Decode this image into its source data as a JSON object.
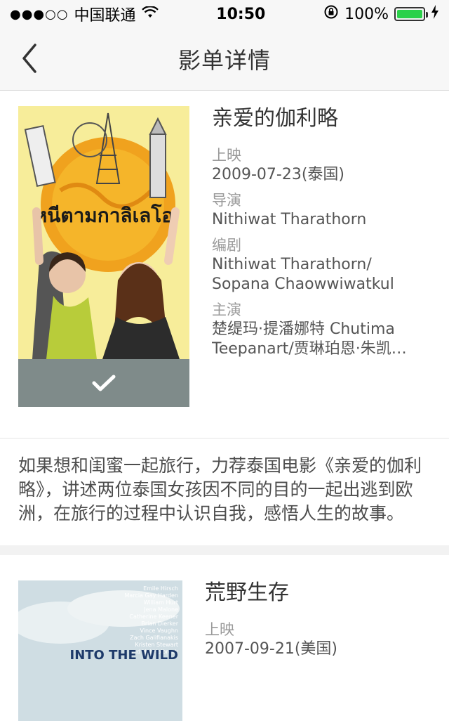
{
  "status_bar": {
    "signal": "●●●○○",
    "carrier": "中国联通",
    "time": "10:50",
    "battery_percent": "100%"
  },
  "nav": {
    "title": "影单详情"
  },
  "movies": [
    {
      "title": "亲爱的伽利略",
      "release_label": "上映",
      "release_value": "2009-07-23(泰国)",
      "director_label": "导演",
      "director_value": "Nithiwat Tharathorn",
      "writer_label": "编剧",
      "writer_value": "Nithiwat Tharathorn/ Sopana Chaowwiwatkul",
      "cast_label": "主演",
      "cast_value": "楚缇玛·提潘娜特 Chutima Teepanart/贾琳珀恩·朱凯…",
      "poster_title": "หนีตามกาลิเลโอ",
      "selected": true,
      "description": "如果想和闺蜜一起旅行，力荐泰国电影《亲爱的伽利略》，讲述两位泰国女孩因不同的目的一起出逃到欧洲，在旅行的过程中认识自我，感悟人生的故事。"
    },
    {
      "title": "荒野生存",
      "release_label": "上映",
      "release_value": "2007-09-21(美国)",
      "poster_cast": [
        "Emile Hirsch",
        "Marcia Gay Harden",
        "William Hurt",
        "Jena Malone",
        "Catherine Keener",
        "Brian Dierker",
        "Vince Vaughn",
        "Zach Galifianakis",
        "Kristen Stewart",
        "and Hal Holbrook"
      ],
      "poster_title": "INTO THE WILD"
    }
  ]
}
